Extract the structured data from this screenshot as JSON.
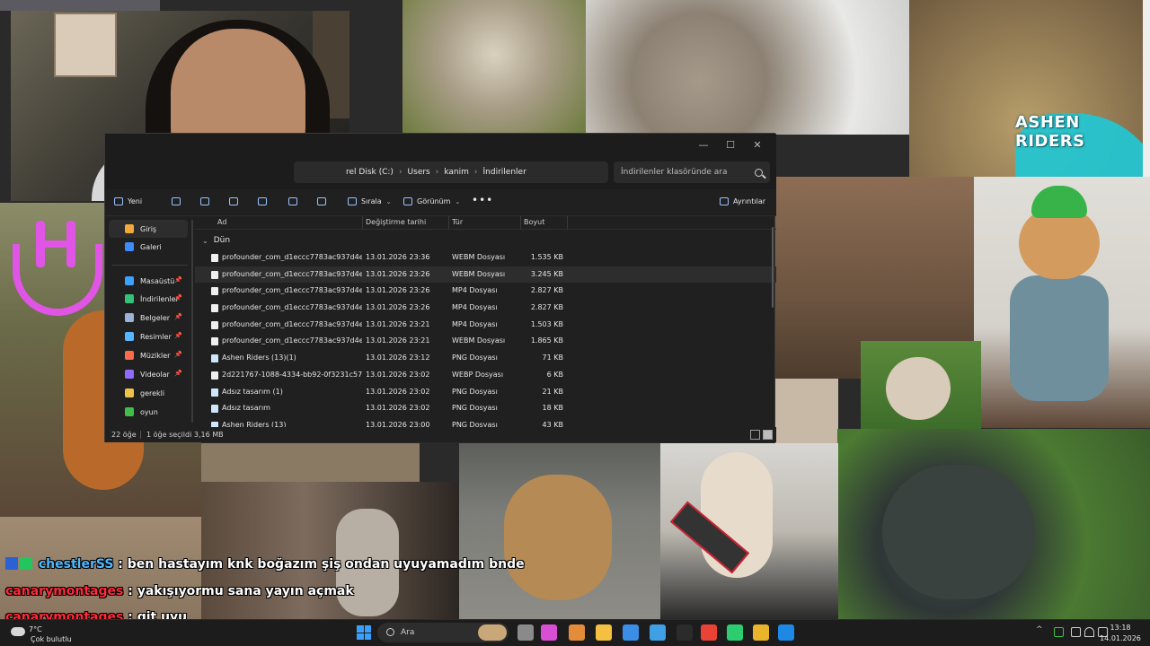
{
  "background": {
    "logo_text": "ASHEN RIDERS"
  },
  "explorer": {
    "window_controls": {
      "minimize": "—",
      "maximize": "☐",
      "close": "✕"
    },
    "address": {
      "segments": [
        "rel Disk (C:)",
        "Users",
        "kanim",
        "İndirilenler"
      ],
      "separator": "›"
    },
    "search": {
      "placeholder": "İndirilenler klasöründe ara"
    },
    "toolbar": {
      "new_label": "Yeni",
      "sort_label": "Sırala",
      "view_label": "Görünüm",
      "more_label": "•••",
      "details_label": "Ayrıntılar"
    },
    "nav": {
      "items": [
        {
          "label": "Giriş",
          "icon": "home-icon",
          "color": "#f2a83b",
          "pinned": false,
          "selected": true
        },
        {
          "label": "Galeri",
          "icon": "gallery-icon",
          "color": "#3d8bff",
          "pinned": false,
          "selected": false
        },
        {
          "label": "Masaüstü",
          "icon": "desktop-icon",
          "color": "#3da1ff",
          "pinned": true,
          "selected": false
        },
        {
          "label": "İndirilenler",
          "icon": "download-icon",
          "color": "#33c27a",
          "pinned": true,
          "selected": false
        },
        {
          "label": "Belgeler",
          "icon": "documents-icon",
          "color": "#9ab3d6",
          "pinned": true,
          "selected": false
        },
        {
          "label": "Resimler",
          "icon": "pictures-icon",
          "color": "#56b6ff",
          "pinned": true,
          "selected": false
        },
        {
          "label": "Müzikler",
          "icon": "music-icon",
          "color": "#ff6a4a",
          "pinned": true,
          "selected": false
        },
        {
          "label": "Videolar",
          "icon": "videos-icon",
          "color": "#8f6bff",
          "pinned": true,
          "selected": false
        },
        {
          "label": "gerekli",
          "icon": "folder-icon",
          "color": "#f0c24a",
          "pinned": false,
          "selected": false
        },
        {
          "label": "oyun",
          "icon": "folder-icon",
          "color": "#3fbf4a",
          "pinned": false,
          "selected": false
        }
      ],
      "pin_glyph": "📌"
    },
    "columns": {
      "name": "Ad",
      "date": "Değiştirme tarihi",
      "type": "Tür",
      "size": "Boyut"
    },
    "group": {
      "label": "Dün"
    },
    "files": [
      {
        "name": "profounder_com_d1eccc7783ac937d4e2f...",
        "date": "13.01.2026 23:36",
        "type": "WEBM Dosyası",
        "size": "1.535 KB",
        "selected": false
      },
      {
        "name": "profounder_com_d1eccc7783ac937d4e2f...",
        "date": "13.01.2026 23:26",
        "type": "WEBM Dosyası",
        "size": "3.245 KB",
        "selected": true
      },
      {
        "name": "profounder_com_d1eccc7783ac937d4e2f...",
        "date": "13.01.2026 23:26",
        "type": "MP4 Dosyası",
        "size": "2.827 KB",
        "selected": false
      },
      {
        "name": "profounder_com_d1eccc7783ac937d4e2f...",
        "date": "13.01.2026 23:26",
        "type": "MP4 Dosyası",
        "size": "2.827 KB",
        "selected": false
      },
      {
        "name": "profounder_com_d1eccc7783ac937d4e2f...",
        "date": "13.01.2026 23:21",
        "type": "MP4 Dosyası",
        "size": "1.503 KB",
        "selected": false
      },
      {
        "name": "profounder_com_d1eccc7783ac937d4e2f...",
        "date": "13.01.2026 23:21",
        "type": "WEBM Dosyası",
        "size": "1.865 KB",
        "selected": false
      },
      {
        "name": "Ashen Riders (13)(1)",
        "date": "13.01.2026 23:12",
        "type": "PNG Dosyası",
        "size": "71 KB",
        "selected": false
      },
      {
        "name": "2d221767-1088-4334-bb92-0f3231c5746e...",
        "date": "13.01.2026 23:02",
        "type": "WEBP Dosyası",
        "size": "6 KB",
        "selected": false
      },
      {
        "name": "Adsız tasarım (1)",
        "date": "13.01.2026 23:02",
        "type": "PNG Dosyası",
        "size": "21 KB",
        "selected": false
      },
      {
        "name": "Adsız tasarım",
        "date": "13.01.2026 23:02",
        "type": "PNG Dosyası",
        "size": "18 KB",
        "selected": false
      },
      {
        "name": "Ashen Riders (13)",
        "date": "13.01.2026 23:00",
        "type": "PNG Dosyası",
        "size": "43 KB",
        "selected": false
      }
    ],
    "status": {
      "count": "22 öğe",
      "selection": "1 öğe seçildi  3,16 MB"
    }
  },
  "chat": [
    {
      "user": "chestlerSS",
      "message": ": ben hastayım knk boğazım şiş ondan uyuyamadım bnde"
    },
    {
      "user": "canarymontages",
      "message": ": yakışıyormu sana yayın açmak"
    },
    {
      "user": "canarymontages",
      "message": ": git uyu"
    }
  ],
  "taskbar": {
    "weather": {
      "temp": "7°C",
      "condition": "Çok bulutlu"
    },
    "search_label": "Ara",
    "clock": {
      "time": "13:18",
      "date": "14.01.2026"
    },
    "app_colors": [
      "#8a8a8a",
      "#d94fd4",
      "#e48c3a",
      "#f5c042",
      "#3a8ee6",
      "#3fa0e6",
      "#2b2b2b",
      "#ea4335",
      "#2ecc71",
      "#e9b52b",
      "#1e88e5"
    ]
  }
}
